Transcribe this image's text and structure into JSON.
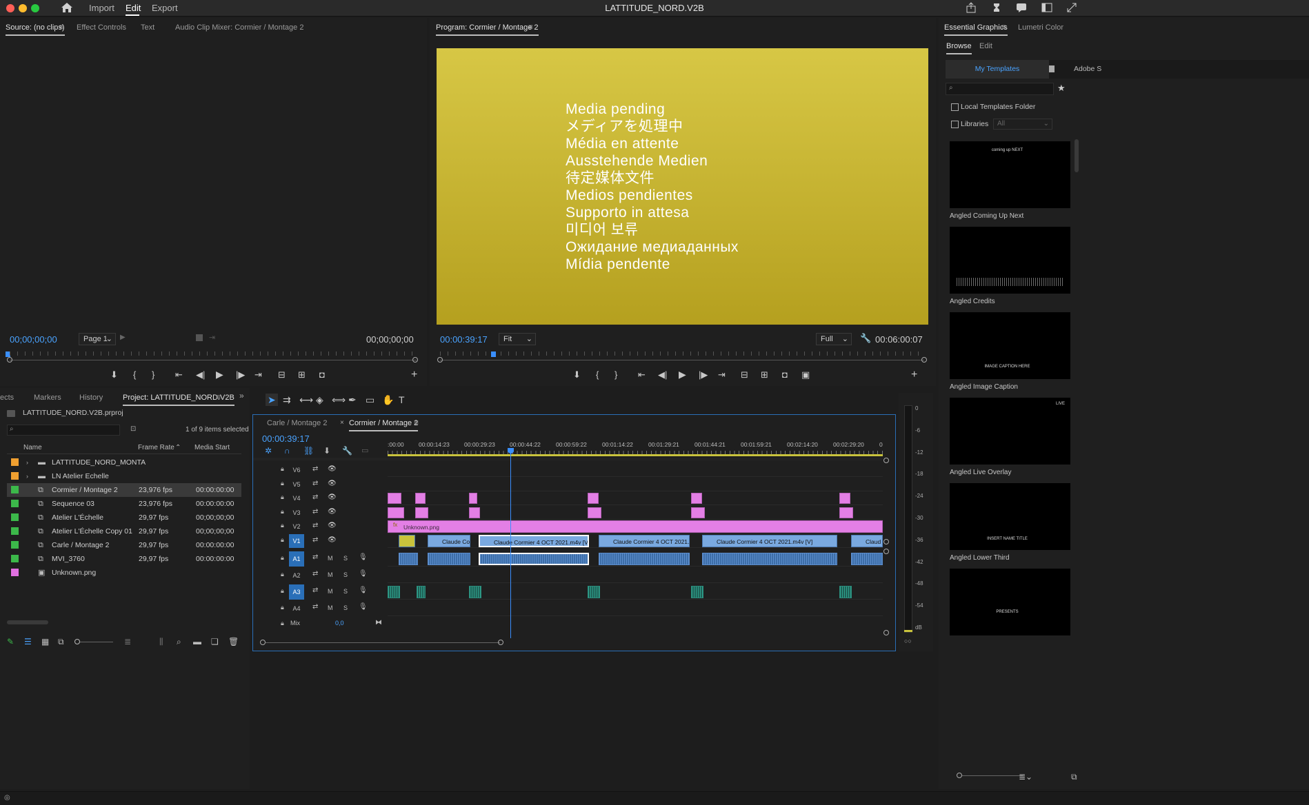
{
  "app": {
    "title": "LATTITUDE_NORD.V2B",
    "menu": [
      "Import",
      "Edit",
      "Export"
    ],
    "active_menu": "Edit"
  },
  "source_panel": {
    "tabs": [
      "Source: (no clips)",
      "Effect Controls",
      "Text",
      "Audio Clip Mixer: Cormier / Montage 2"
    ],
    "timecode_left": "00;00;00;00",
    "timecode_right": "00;00;00;00",
    "page_select": "Page 1"
  },
  "program_panel": {
    "title": "Program: Cormier / Montage 2",
    "timecode": "00:00:39:17",
    "duration": "00:06:00:07",
    "fit": "Fit",
    "quality": "Full",
    "media_pending_lines": [
      "Media pending",
      "メディアを処理中",
      "Média en attente",
      "Ausstehende Medien",
      "待定媒体文件",
      "Medios pendientes",
      "Supporto in attesa",
      "미디어 보류",
      "Ожидание медиаданных",
      "Mídia pendente"
    ],
    "playhead_fraction": 0.11
  },
  "project_panel": {
    "tabs": [
      "ects",
      "Markers",
      "History",
      "Project: LATTITUDE_NORD.V2B"
    ],
    "project_file": "LATTITUDE_NORD.V2B.prproj",
    "selection_status": "1 of 9 items selected",
    "columns": [
      "Name",
      "Frame Rate",
      "Media Start"
    ],
    "items": [
      {
        "color": "#f0a030",
        "type": "folder",
        "name": "LATTITUDE_NORD_MONTA",
        "frame_rate": "",
        "media_start": ""
      },
      {
        "color": "#f0a030",
        "type": "folder",
        "name": "LN Atelier Echelle",
        "frame_rate": "",
        "media_start": ""
      },
      {
        "color": "#3cb84a",
        "type": "sequence",
        "name": "Cormier / Montage 2",
        "frame_rate": "23,976 fps",
        "media_start": "00:00:00:00"
      },
      {
        "color": "#3cb84a",
        "type": "sequence",
        "name": "Sequence 03",
        "frame_rate": "23,976 fps",
        "media_start": "00:00:00:00"
      },
      {
        "color": "#3cb84a",
        "type": "sequence",
        "name": "Atelier L'Échelle",
        "frame_rate": "29,97 fps",
        "media_start": "00;00;00;00"
      },
      {
        "color": "#3cb84a",
        "type": "sequence",
        "name": "Atelier L'Échelle Copy 01",
        "frame_rate": "29,97 fps",
        "media_start": "00;00;00;00"
      },
      {
        "color": "#3cb84a",
        "type": "sequence",
        "name": "Carle / Montage 2",
        "frame_rate": "29,97 fps",
        "media_start": "00:00:00:00"
      },
      {
        "color": "#3cb84a",
        "type": "sequence",
        "name": "MVI_3760",
        "frame_rate": "29,97 fps",
        "media_start": "00:00:00:00"
      },
      {
        "color": "#e070e0",
        "type": "image",
        "name": "Unknown.png",
        "frame_rate": "",
        "media_start": ""
      }
    ]
  },
  "timeline": {
    "tabs": [
      "Carle / Montage 2",
      "Cormier / Montage 2"
    ],
    "timecode": "00:00:39:17",
    "ruler": [
      ":00:00",
      "00:00:14:23",
      "00:00:29:23",
      "00:00:44:22",
      "00:00:59:22",
      "00:01:14:22",
      "00:01:29:21",
      "00:01:44:21",
      "00:01:59:21",
      "00:02:14:20",
      "00:02:29:20",
      "0"
    ],
    "video_tracks": [
      "V6",
      "V5",
      "V4",
      "V3",
      "V2",
      "V1"
    ],
    "audio_tracks": [
      "A1",
      "A2",
      "A3",
      "A4"
    ],
    "mix_label": "Mix",
    "mix_value": "0,0",
    "track_buttons": {
      "mute": "M",
      "solo": "S"
    },
    "clips": {
      "v2": "Unknown.png",
      "v1": [
        "Claude Cor",
        "Claude Cormier 4 OCT 2021.m4v [V]",
        "Claude Cormier 4 OCT 2021.m4",
        "Claude Cormier 4 OCT 2021.m4v [V]",
        "Claud"
      ]
    },
    "meter_scale": [
      "0",
      "-6",
      "-12",
      "-18",
      "-24",
      "-30",
      "-36",
      "-42",
      "-48",
      "-54",
      "dB"
    ]
  },
  "essential_graphics": {
    "tabs": [
      "Essential Graphics",
      "Lumetri Color"
    ],
    "subtabs": [
      "Browse",
      "Edit"
    ],
    "template_tabs": [
      "My Templates",
      "Adobe S"
    ],
    "local_templates": "Local Templates Folder",
    "libraries": "Libraries",
    "libraries_select": "All",
    "templates": [
      {
        "name": "Angled Coming Up Next",
        "thumb_text": "coming up NEXT"
      },
      {
        "name": "Angled Credits",
        "thumb_text": ""
      },
      {
        "name": "Angled Image Caption",
        "thumb_text": "IMAGE CAPTION HERE"
      },
      {
        "name": "Angled Live Overlay",
        "thumb_text": "LIVE"
      },
      {
        "name": "Angled Lower Third",
        "thumb_text": "INSERT NAME TITLE"
      },
      {
        "name": "",
        "thumb_text": "PRESENTS"
      }
    ]
  },
  "colors": {
    "accent_blue": "#4aa3ff",
    "pink_clip": "#e37fe5",
    "blue_clip": "#7aa9e0",
    "audio_clip": "#1f5f55"
  }
}
